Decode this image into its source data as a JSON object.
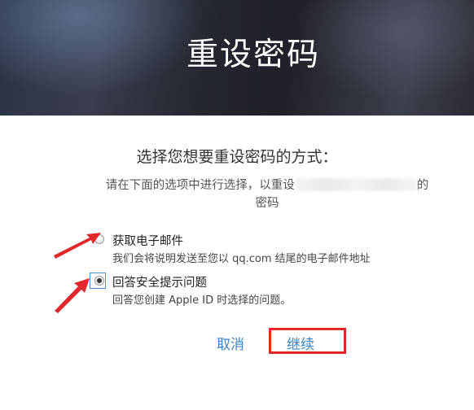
{
  "hero": {
    "title": "重设密码"
  },
  "heading": "选择您想要重设密码的方式：",
  "description": {
    "prefix": "请在下面的选项中进行选择，以重设",
    "suffix_end": "的",
    "line2": "密码"
  },
  "options": [
    {
      "label": "获取电子邮件",
      "sub": "我们会将说明发送至您以 qq.com 结尾的电子邮件地址",
      "selected": false
    },
    {
      "label": "回答安全提示问题",
      "sub": "回答您创建 Apple ID 时选择的问题。",
      "selected": true
    }
  ],
  "buttons": {
    "cancel": "取消",
    "continue": "继续"
  },
  "colors": {
    "accent": "#3a82c9",
    "highlight": "#e0272b"
  }
}
